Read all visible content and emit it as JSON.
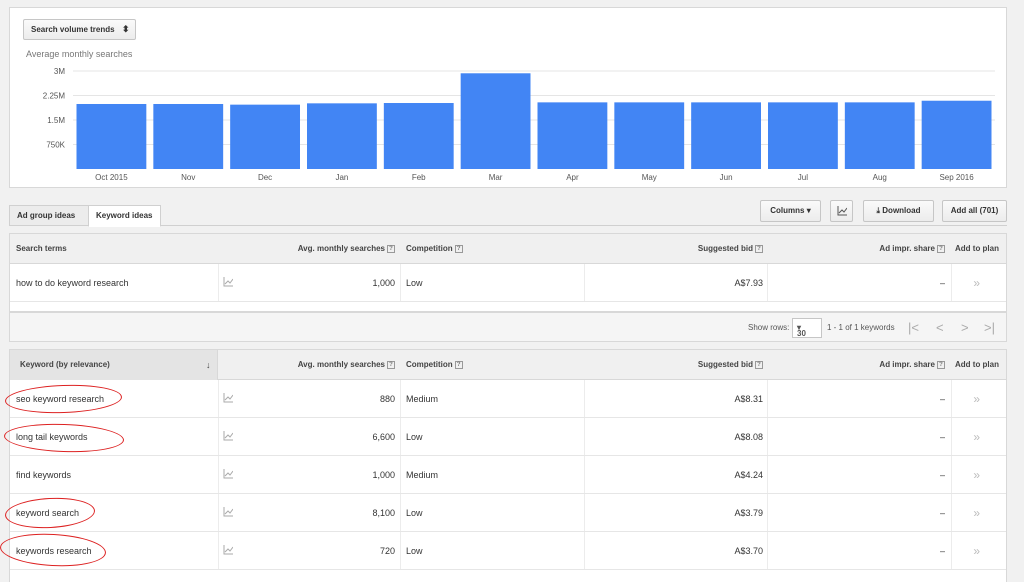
{
  "chart_panel": {
    "selector_label": "Search volume trends",
    "subtitle": "Average monthly searches"
  },
  "chart_data": {
    "type": "bar",
    "categories": [
      "Oct 2015",
      "Nov",
      "Dec",
      "Jan",
      "Feb",
      "Mar",
      "Apr",
      "May",
      "Jun",
      "Jul",
      "Aug",
      "Sep 2016"
    ],
    "values": [
      1990000,
      1990000,
      1970000,
      2010000,
      2020000,
      2930000,
      2040000,
      2040000,
      2040000,
      2040000,
      2040000,
      2090000
    ],
    "ytick_labels": [
      "3M",
      "2.25M",
      "1.5M",
      "750K"
    ],
    "yticks": [
      3000000,
      2250000,
      1500000,
      750000
    ],
    "ylim": [
      0,
      3000000
    ],
    "grid": true,
    "color": "#4285f4"
  },
  "tabs": {
    "ad_group": "Ad group ideas",
    "keyword": "Keyword ideas"
  },
  "toolbar": {
    "columns": "Columns",
    "download": "Download",
    "add_all": "Add all (701)"
  },
  "search_table": {
    "headers": {
      "term": "Search terms",
      "avg": "Avg. monthly searches",
      "competition": "Competition",
      "bid": "Suggested bid",
      "impr": "Ad impr. share",
      "plan": "Add to plan"
    },
    "row": {
      "term": "how to do keyword research",
      "avg": "1,000",
      "competition": "Low",
      "bid": "A$7.93",
      "impr": "–"
    }
  },
  "pager": {
    "show_rows_label": "Show rows:",
    "rows_value": "30",
    "range": "1 - 1 of 1 keywords"
  },
  "keyword_table": {
    "headers": {
      "keyword": "Keyword (by relevance)",
      "avg": "Avg. monthly searches",
      "competition": "Competition",
      "bid": "Suggested bid",
      "impr": "Ad impr. share",
      "plan": "Add to plan"
    },
    "rows": [
      {
        "keyword": "seo keyword research",
        "avg": "880",
        "competition": "Medium",
        "bid": "A$8.31",
        "impr": "–"
      },
      {
        "keyword": "long tail keywords",
        "avg": "6,600",
        "competition": "Low",
        "bid": "A$8.08",
        "impr": "–"
      },
      {
        "keyword": "find keywords",
        "avg": "1,000",
        "competition": "Medium",
        "bid": "A$4.24",
        "impr": "–"
      },
      {
        "keyword": "keyword search",
        "avg": "8,100",
        "competition": "Low",
        "bid": "A$3.79",
        "impr": "–"
      },
      {
        "keyword": "keywords research",
        "avg": "720",
        "competition": "Low",
        "bid": "A$3.70",
        "impr": "–"
      }
    ]
  },
  "icons": {
    "sort": "down-arrow-icon",
    "spark": "line-chart-icon",
    "add": "double-chevron-right-icon",
    "download": "download-icon"
  }
}
